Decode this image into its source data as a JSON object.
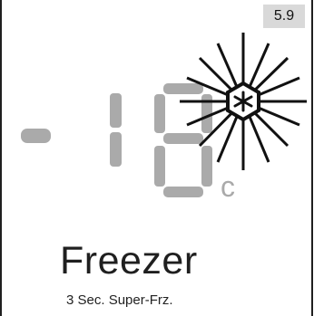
{
  "version_badge": "5.9",
  "display": {
    "minus_sign": "-",
    "temperature_digits": "18",
    "unit": "c",
    "segment_color": "#aaaaaa",
    "icon": "snowflake-icon"
  },
  "title": "Freezer",
  "subtitle": "3 Sec. Super-Frz."
}
